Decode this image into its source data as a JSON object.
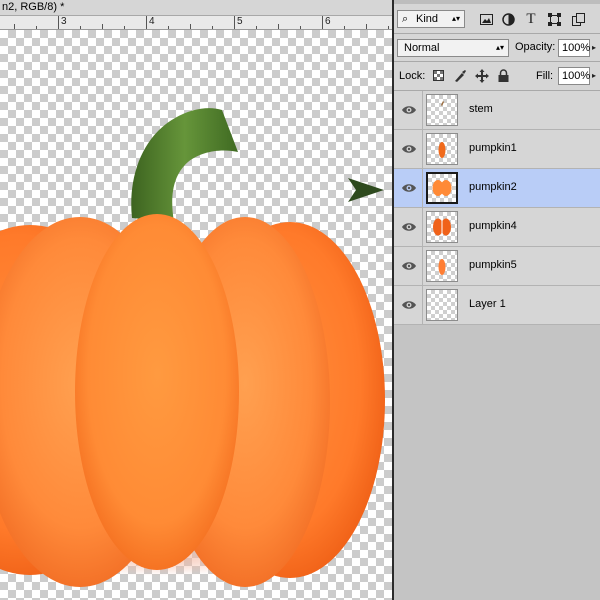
{
  "document": {
    "tab_title": "n2, RGB/8) *",
    "ruler_numbers": [
      "3",
      "4",
      "5",
      "6"
    ]
  },
  "layers_panel": {
    "filter": {
      "kind_label": "Kind",
      "icons": [
        "image-filter-icon",
        "adjustment-filter-icon",
        "type-filter-icon",
        "shape-filter-icon",
        "smart-object-filter-icon"
      ]
    },
    "blend_mode": "Normal",
    "opacity_label": "Opacity:",
    "opacity_value": "100%",
    "lock_label": "Lock:",
    "fill_label": "Fill:",
    "fill_value": "100%",
    "layers": [
      {
        "name": "stem",
        "selected": false,
        "thumb": "stem"
      },
      {
        "name": "pumpkin1",
        "selected": false,
        "thumb": "small"
      },
      {
        "name": "pumpkin2",
        "selected": true,
        "thumb": "pair"
      },
      {
        "name": "pumpkin4",
        "selected": false,
        "thumb": "pair-red"
      },
      {
        "name": "pumpkin5",
        "selected": false,
        "thumb": "small"
      },
      {
        "name": "Layer 1",
        "selected": false,
        "thumb": "empty"
      }
    ]
  },
  "colors": {
    "pumpkin": "#ff8a36",
    "pumpkin_dark": "#f2621a",
    "stem": "#4f7a2b",
    "selection": "#b9cdf7",
    "arrow": "#2e4a1e"
  }
}
